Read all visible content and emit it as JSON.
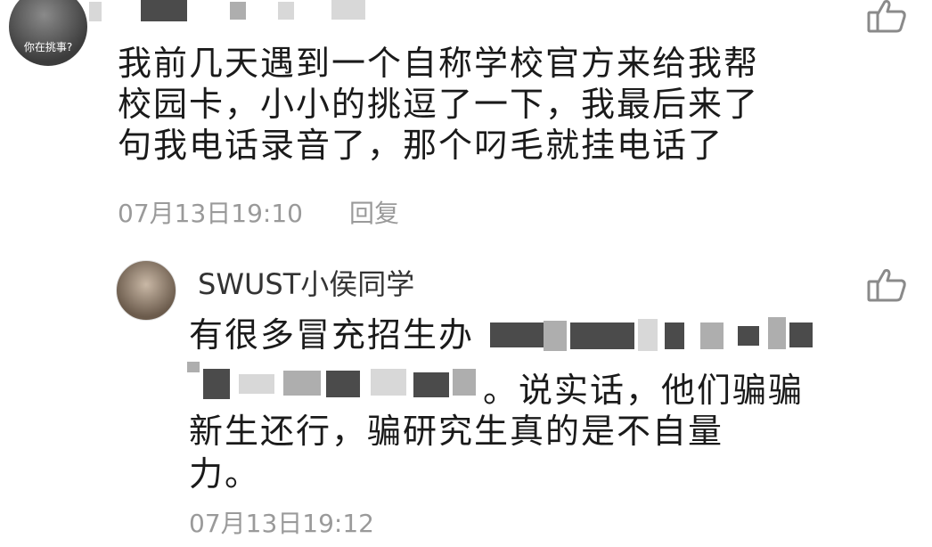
{
  "comment": {
    "avatar_caption": "你在挑事?",
    "lines": [
      "我前几天遇到一个自称学校官方来给我帮",
      "校园卡，小小的挑逗了一下，我最后来了",
      "句我电话录音了，那个叼毛就挂电话了"
    ],
    "timestamp": "07月13日19:10",
    "reply_label": "回复"
  },
  "reply": {
    "username": "SWUST小侯同学",
    "line1": "有很多冒充招生办",
    "line2": "。说实话，他们骗骗",
    "line3": "新生还行，骗研究生真的是不自量",
    "line4": "力。",
    "timestamp": "07月13日19:12"
  }
}
